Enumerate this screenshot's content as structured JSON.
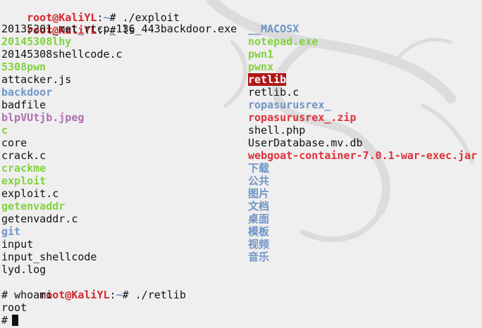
{
  "prompt": {
    "user_host": "root@KaliYL",
    "sep": ":",
    "dir": "~",
    "symbol": "#"
  },
  "history": [
    {
      "command": "./exploit"
    },
    {
      "command": "ls"
    }
  ],
  "ls": {
    "col1": [
      {
        "name": "20135201_met_rtcp_136_443backdoor.exe",
        "kind": "file"
      },
      {
        "name": "20145308lhy",
        "kind": "exec"
      },
      {
        "name": "20145308shellcode.c",
        "kind": "file"
      },
      {
        "name": "5308pwn",
        "kind": "exec"
      },
      {
        "name": "attacker.js",
        "kind": "file"
      },
      {
        "name": "backdoor",
        "kind": "dir"
      },
      {
        "name": "badfile",
        "kind": "file"
      },
      {
        "name": "blpVUtjb.jpeg",
        "kind": "img"
      },
      {
        "name": "c",
        "kind": "exec"
      },
      {
        "name": "core",
        "kind": "file"
      },
      {
        "name": "crack.c",
        "kind": "file"
      },
      {
        "name": "crackme",
        "kind": "exec"
      },
      {
        "name": "exploit",
        "kind": "exec"
      },
      {
        "name": "exploit.c",
        "kind": "file"
      },
      {
        "name": "getenvaddr",
        "kind": "exec"
      },
      {
        "name": "getenvaddr.c",
        "kind": "file"
      },
      {
        "name": "git",
        "kind": "dir"
      },
      {
        "name": "input",
        "kind": "file"
      },
      {
        "name": "input_shellcode",
        "kind": "file"
      },
      {
        "name": "lyd.log",
        "kind": "file"
      }
    ],
    "col2": [
      {
        "name": "__MACOSX",
        "kind": "dir"
      },
      {
        "name": "notepad.exe",
        "kind": "exec"
      },
      {
        "name": "pwn1",
        "kind": "exec"
      },
      {
        "name": "pwnx",
        "kind": "exec"
      },
      {
        "name": "retlib",
        "kind": "sel"
      },
      {
        "name": "retlib.c",
        "kind": "file"
      },
      {
        "name": "ropasurusrex_",
        "kind": "dir"
      },
      {
        "name": "ropasurusrex_.zip",
        "kind": "archive"
      },
      {
        "name": "shell.php",
        "kind": "file"
      },
      {
        "name": "UserDatabase.mv.db",
        "kind": "file"
      },
      {
        "name": "webgoat-container-7.0.1-war-exec.jar",
        "kind": "archive"
      },
      {
        "name": "下载",
        "kind": "dir"
      },
      {
        "name": "公共",
        "kind": "dir"
      },
      {
        "name": "图片",
        "kind": "dir"
      },
      {
        "name": "文档",
        "kind": "dir"
      },
      {
        "name": "桌面",
        "kind": "dir"
      },
      {
        "name": "模板",
        "kind": "dir"
      },
      {
        "name": "视频",
        "kind": "dir"
      },
      {
        "name": "音乐",
        "kind": "dir"
      }
    ]
  },
  "after": {
    "command": "./retlib",
    "root_prompt": "# ",
    "whoami_cmd": "whoami",
    "whoami_out": "root",
    "last_prompt": "#"
  },
  "colors": {
    "background": "#efefef",
    "prompt_user": "#d3262e",
    "directory": "#6f95c8",
    "executable": "#82d23f",
    "image": "#b070b0",
    "archive": "#e0303a",
    "selection_bg": "#b01818"
  },
  "icons": {
    "background_art": "kali-dragon-icon"
  }
}
